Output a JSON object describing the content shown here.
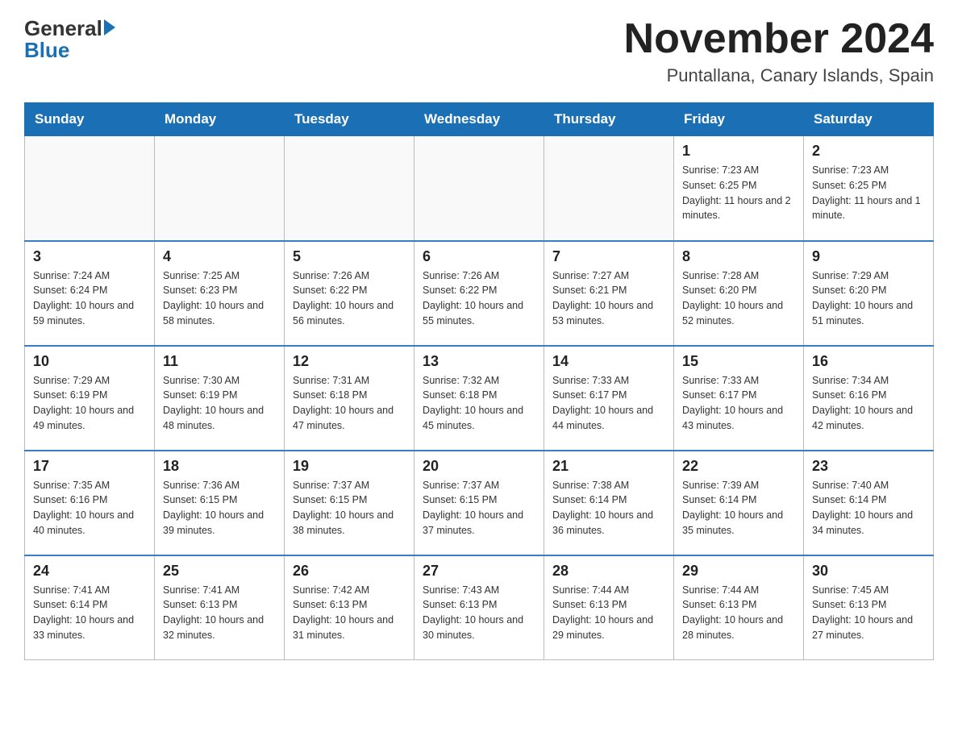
{
  "header": {
    "logo_general": "General",
    "logo_blue": "Blue",
    "month_year": "November 2024",
    "location": "Puntallana, Canary Islands, Spain"
  },
  "weekdays": [
    "Sunday",
    "Monday",
    "Tuesday",
    "Wednesday",
    "Thursday",
    "Friday",
    "Saturday"
  ],
  "weeks": [
    [
      {
        "day": "",
        "info": ""
      },
      {
        "day": "",
        "info": ""
      },
      {
        "day": "",
        "info": ""
      },
      {
        "day": "",
        "info": ""
      },
      {
        "day": "",
        "info": ""
      },
      {
        "day": "1",
        "info": "Sunrise: 7:23 AM\nSunset: 6:25 PM\nDaylight: 11 hours and 2 minutes."
      },
      {
        "day": "2",
        "info": "Sunrise: 7:23 AM\nSunset: 6:25 PM\nDaylight: 11 hours and 1 minute."
      }
    ],
    [
      {
        "day": "3",
        "info": "Sunrise: 7:24 AM\nSunset: 6:24 PM\nDaylight: 10 hours and 59 minutes."
      },
      {
        "day": "4",
        "info": "Sunrise: 7:25 AM\nSunset: 6:23 PM\nDaylight: 10 hours and 58 minutes."
      },
      {
        "day": "5",
        "info": "Sunrise: 7:26 AM\nSunset: 6:22 PM\nDaylight: 10 hours and 56 minutes."
      },
      {
        "day": "6",
        "info": "Sunrise: 7:26 AM\nSunset: 6:22 PM\nDaylight: 10 hours and 55 minutes."
      },
      {
        "day": "7",
        "info": "Sunrise: 7:27 AM\nSunset: 6:21 PM\nDaylight: 10 hours and 53 minutes."
      },
      {
        "day": "8",
        "info": "Sunrise: 7:28 AM\nSunset: 6:20 PM\nDaylight: 10 hours and 52 minutes."
      },
      {
        "day": "9",
        "info": "Sunrise: 7:29 AM\nSunset: 6:20 PM\nDaylight: 10 hours and 51 minutes."
      }
    ],
    [
      {
        "day": "10",
        "info": "Sunrise: 7:29 AM\nSunset: 6:19 PM\nDaylight: 10 hours and 49 minutes."
      },
      {
        "day": "11",
        "info": "Sunrise: 7:30 AM\nSunset: 6:19 PM\nDaylight: 10 hours and 48 minutes."
      },
      {
        "day": "12",
        "info": "Sunrise: 7:31 AM\nSunset: 6:18 PM\nDaylight: 10 hours and 47 minutes."
      },
      {
        "day": "13",
        "info": "Sunrise: 7:32 AM\nSunset: 6:18 PM\nDaylight: 10 hours and 45 minutes."
      },
      {
        "day": "14",
        "info": "Sunrise: 7:33 AM\nSunset: 6:17 PM\nDaylight: 10 hours and 44 minutes."
      },
      {
        "day": "15",
        "info": "Sunrise: 7:33 AM\nSunset: 6:17 PM\nDaylight: 10 hours and 43 minutes."
      },
      {
        "day": "16",
        "info": "Sunrise: 7:34 AM\nSunset: 6:16 PM\nDaylight: 10 hours and 42 minutes."
      }
    ],
    [
      {
        "day": "17",
        "info": "Sunrise: 7:35 AM\nSunset: 6:16 PM\nDaylight: 10 hours and 40 minutes."
      },
      {
        "day": "18",
        "info": "Sunrise: 7:36 AM\nSunset: 6:15 PM\nDaylight: 10 hours and 39 minutes."
      },
      {
        "day": "19",
        "info": "Sunrise: 7:37 AM\nSunset: 6:15 PM\nDaylight: 10 hours and 38 minutes."
      },
      {
        "day": "20",
        "info": "Sunrise: 7:37 AM\nSunset: 6:15 PM\nDaylight: 10 hours and 37 minutes."
      },
      {
        "day": "21",
        "info": "Sunrise: 7:38 AM\nSunset: 6:14 PM\nDaylight: 10 hours and 36 minutes."
      },
      {
        "day": "22",
        "info": "Sunrise: 7:39 AM\nSunset: 6:14 PM\nDaylight: 10 hours and 35 minutes."
      },
      {
        "day": "23",
        "info": "Sunrise: 7:40 AM\nSunset: 6:14 PM\nDaylight: 10 hours and 34 minutes."
      }
    ],
    [
      {
        "day": "24",
        "info": "Sunrise: 7:41 AM\nSunset: 6:14 PM\nDaylight: 10 hours and 33 minutes."
      },
      {
        "day": "25",
        "info": "Sunrise: 7:41 AM\nSunset: 6:13 PM\nDaylight: 10 hours and 32 minutes."
      },
      {
        "day": "26",
        "info": "Sunrise: 7:42 AM\nSunset: 6:13 PM\nDaylight: 10 hours and 31 minutes."
      },
      {
        "day": "27",
        "info": "Sunrise: 7:43 AM\nSunset: 6:13 PM\nDaylight: 10 hours and 30 minutes."
      },
      {
        "day": "28",
        "info": "Sunrise: 7:44 AM\nSunset: 6:13 PM\nDaylight: 10 hours and 29 minutes."
      },
      {
        "day": "29",
        "info": "Sunrise: 7:44 AM\nSunset: 6:13 PM\nDaylight: 10 hours and 28 minutes."
      },
      {
        "day": "30",
        "info": "Sunrise: 7:45 AM\nSunset: 6:13 PM\nDaylight: 10 hours and 27 minutes."
      }
    ]
  ]
}
